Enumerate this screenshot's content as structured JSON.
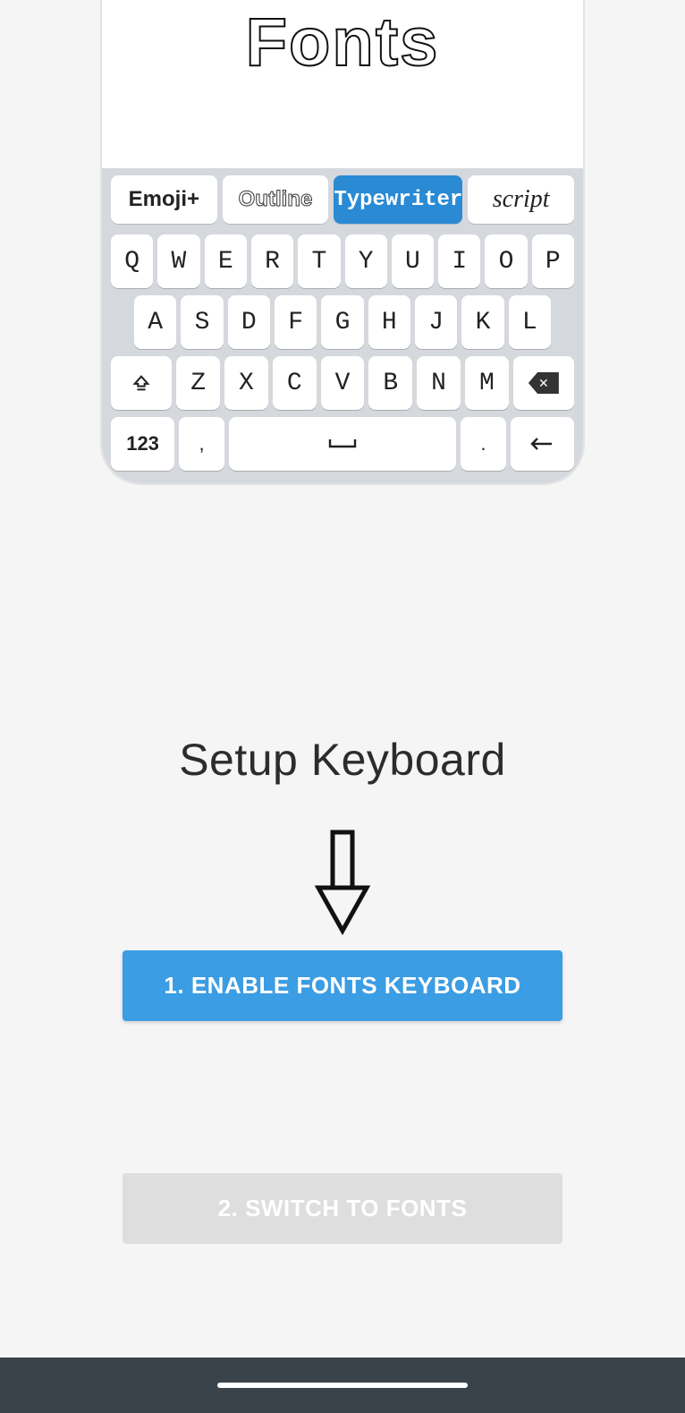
{
  "phone": {
    "title": "Fonts",
    "tabs": [
      "Emoji+",
      "Outline",
      "Typewriter",
      "script"
    ],
    "selected_tab_index": 2,
    "rows": {
      "r1": [
        "Q",
        "W",
        "E",
        "R",
        "T",
        "Y",
        "U",
        "I",
        "O",
        "P"
      ],
      "r2": [
        "A",
        "S",
        "D",
        "F",
        "G",
        "H",
        "J",
        "K",
        "L"
      ],
      "r3": [
        "Z",
        "X",
        "C",
        "V",
        "B",
        "N",
        "M"
      ],
      "shift": "⌃",
      "num": "123",
      "comma": ",",
      "space": "⌴",
      "period": ".",
      "return": "↵",
      "backspace": "×"
    }
  },
  "setup": {
    "heading": "Setup Keyboard",
    "step1": "1. ENABLE FONTS KEYBOARD",
    "step2": "2. SWITCH TO FONTS"
  }
}
